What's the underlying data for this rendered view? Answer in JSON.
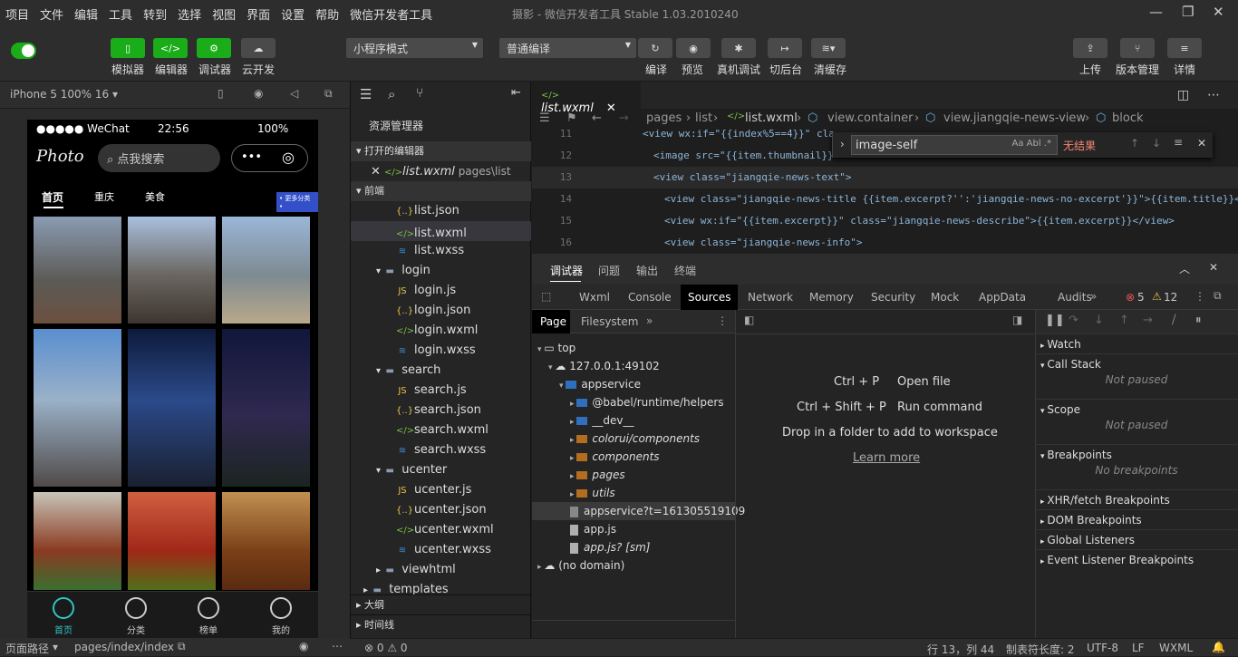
{
  "menu": [
    "项目",
    "文件",
    "编辑",
    "工具",
    "转到",
    "选择",
    "视图",
    "界面",
    "设置",
    "帮助",
    "微信开发者工具"
  ],
  "window_title": "摄影 - 微信开发者工具 Stable 1.03.2010240",
  "toolbar": {
    "left": [
      "模拟器",
      "编辑器",
      "调试器",
      "云开发"
    ],
    "mode": "小程序模式",
    "compile": "普通编译",
    "right_mid": [
      "编译",
      "预览",
      "真机调试",
      "切后台",
      "清缓存"
    ],
    "right": [
      "上传",
      "版本管理",
      "详情"
    ]
  },
  "sim": {
    "device": "iPhone 5 100% 16 ▾",
    "status": {
      "carrier": "●●●●● WeChat",
      "time": "22:56",
      "battery": "100%"
    },
    "logo": "Photo",
    "search": "点我搜索",
    "tabs": [
      "首页",
      "重庆",
      "美食"
    ],
    "more_badge": "• 更多分类 •",
    "tabbar": [
      "首页",
      "分类",
      "榜单",
      "我的"
    ],
    "footer_path_label": "页面路径",
    "footer_path": "pages/index/index"
  },
  "explorer": {
    "title": "资源管理器",
    "open_editors": "打开的编辑器",
    "open_file": "list.wxml",
    "open_file_path": "pages\\list",
    "root": "前端",
    "files": [
      {
        "name": "list.json",
        "type": "json",
        "indent": 2
      },
      {
        "name": "list.wxml",
        "type": "wxml",
        "indent": 2,
        "sel": true
      },
      {
        "name": "list.wxss",
        "type": "wxss",
        "indent": 2
      },
      {
        "name": "login",
        "type": "folder",
        "indent": 1
      },
      {
        "name": "login.js",
        "type": "js",
        "indent": 2
      },
      {
        "name": "login.json",
        "type": "json",
        "indent": 2
      },
      {
        "name": "login.wxml",
        "type": "wxml",
        "indent": 2
      },
      {
        "name": "login.wxss",
        "type": "wxss",
        "indent": 2
      },
      {
        "name": "search",
        "type": "folder",
        "indent": 1
      },
      {
        "name": "search.js",
        "type": "js",
        "indent": 2
      },
      {
        "name": "search.json",
        "type": "json",
        "indent": 2
      },
      {
        "name": "search.wxml",
        "type": "wxml",
        "indent": 2
      },
      {
        "name": "search.wxss",
        "type": "wxss",
        "indent": 2
      },
      {
        "name": "ucenter",
        "type": "folder",
        "indent": 1
      },
      {
        "name": "ucenter.js",
        "type": "js",
        "indent": 2
      },
      {
        "name": "ucenter.json",
        "type": "json",
        "indent": 2
      },
      {
        "name": "ucenter.wxml",
        "type": "wxml",
        "indent": 2
      },
      {
        "name": "ucenter.wxss",
        "type": "wxss",
        "indent": 2
      },
      {
        "name": "viewhtml",
        "type": "folder-closed",
        "indent": 1
      },
      {
        "name": "templates",
        "type": "folder-closed",
        "indent": 0
      }
    ],
    "outline": "大纲",
    "timeline": "时间线"
  },
  "editor": {
    "tab": "list.wxml",
    "breadcrumb": [
      "pages",
      "list",
      "list.wxml",
      "view.container",
      "view.jiangqie-news-view",
      "block"
    ],
    "lines": [
      {
        "n": "11",
        "code": "<view wx:if=\"{{index%5==4}}\" cla"
      },
      {
        "n": "12",
        "code": "  <image src=\"{{item.thumbnail}}"
      },
      {
        "n": "13",
        "code": "  <view class=\"jiangqie-news-text\">"
      },
      {
        "n": "14",
        "code": "    <view class=\"jiangqie-news-title {{item.excerpt?'':'jiangqie-news-no-excerpt'}}\">{{item.title}}</view>"
      },
      {
        "n": "15",
        "code": "    <view wx:if=\"{{item.excerpt}}\" class=\"jiangqie-news-describe\">{{item.excerpt}}</view>"
      },
      {
        "n": "16",
        "code": "    <view class=\"jiangqie-news-info\">"
      }
    ],
    "find": {
      "query": "image-self",
      "options": "Aa  Abl  .*",
      "result": "无结果"
    }
  },
  "devtools": {
    "panel_tabs": [
      "调试器",
      "问题",
      "输出",
      "终端"
    ],
    "tabs": [
      "Wxml",
      "Console",
      "Sources",
      "Network",
      "Memory",
      "Security",
      "Mock",
      "AppData",
      "Audits"
    ],
    "errors": "5",
    "warnings": "12",
    "nav_tabs": [
      "Page",
      "Filesystem"
    ],
    "tree": [
      {
        "label": "top",
        "lvl": 0,
        "kind": "frame"
      },
      {
        "label": "127.0.0.1:49102",
        "lvl": 1,
        "kind": "cloud"
      },
      {
        "label": "appservice",
        "lvl": 2,
        "kind": "folder"
      },
      {
        "label": "@babel/runtime/helpers",
        "lvl": 3,
        "kind": "folder"
      },
      {
        "label": "__dev__",
        "lvl": 3,
        "kind": "folder"
      },
      {
        "label": "colorui/components",
        "lvl": 3,
        "kind": "ofolder"
      },
      {
        "label": "components",
        "lvl": 3,
        "kind": "ofolder"
      },
      {
        "label": "pages",
        "lvl": 3,
        "kind": "ofolder"
      },
      {
        "label": "utils",
        "lvl": 3,
        "kind": "ofolder"
      },
      {
        "label": "appservice?t=161305519109",
        "lvl": 3,
        "kind": "file",
        "sel": true
      },
      {
        "label": "app.js",
        "lvl": 3,
        "kind": "file"
      },
      {
        "label": "app.js? [sm]",
        "lvl": 3,
        "kind": "file"
      },
      {
        "label": "(no domain)",
        "lvl": 0,
        "kind": "cloud"
      }
    ],
    "shortcuts": [
      {
        "keys": "Ctrl + P",
        "label": "Open file"
      },
      {
        "keys": "Ctrl + Shift + P",
        "label": "Run command"
      }
    ],
    "drop_text": "Drop in a folder to add to workspace",
    "learn_more": "Learn more",
    "right": [
      "Watch",
      "Call Stack",
      "Scope",
      "Breakpoints",
      "XHR/fetch Breakpoints",
      "DOM Breakpoints",
      "Global Listeners",
      "Event Listener Breakpoints"
    ],
    "not_paused": "Not paused",
    "no_breakpoints": "No breakpoints"
  },
  "statusbar": {
    "problems": "⊗ 0 ⚠ 0",
    "pos": "行 13，列 44",
    "tab": "制表符长度: 2",
    "enc": "UTF-8",
    "eol": "LF",
    "lang": "WXML"
  }
}
